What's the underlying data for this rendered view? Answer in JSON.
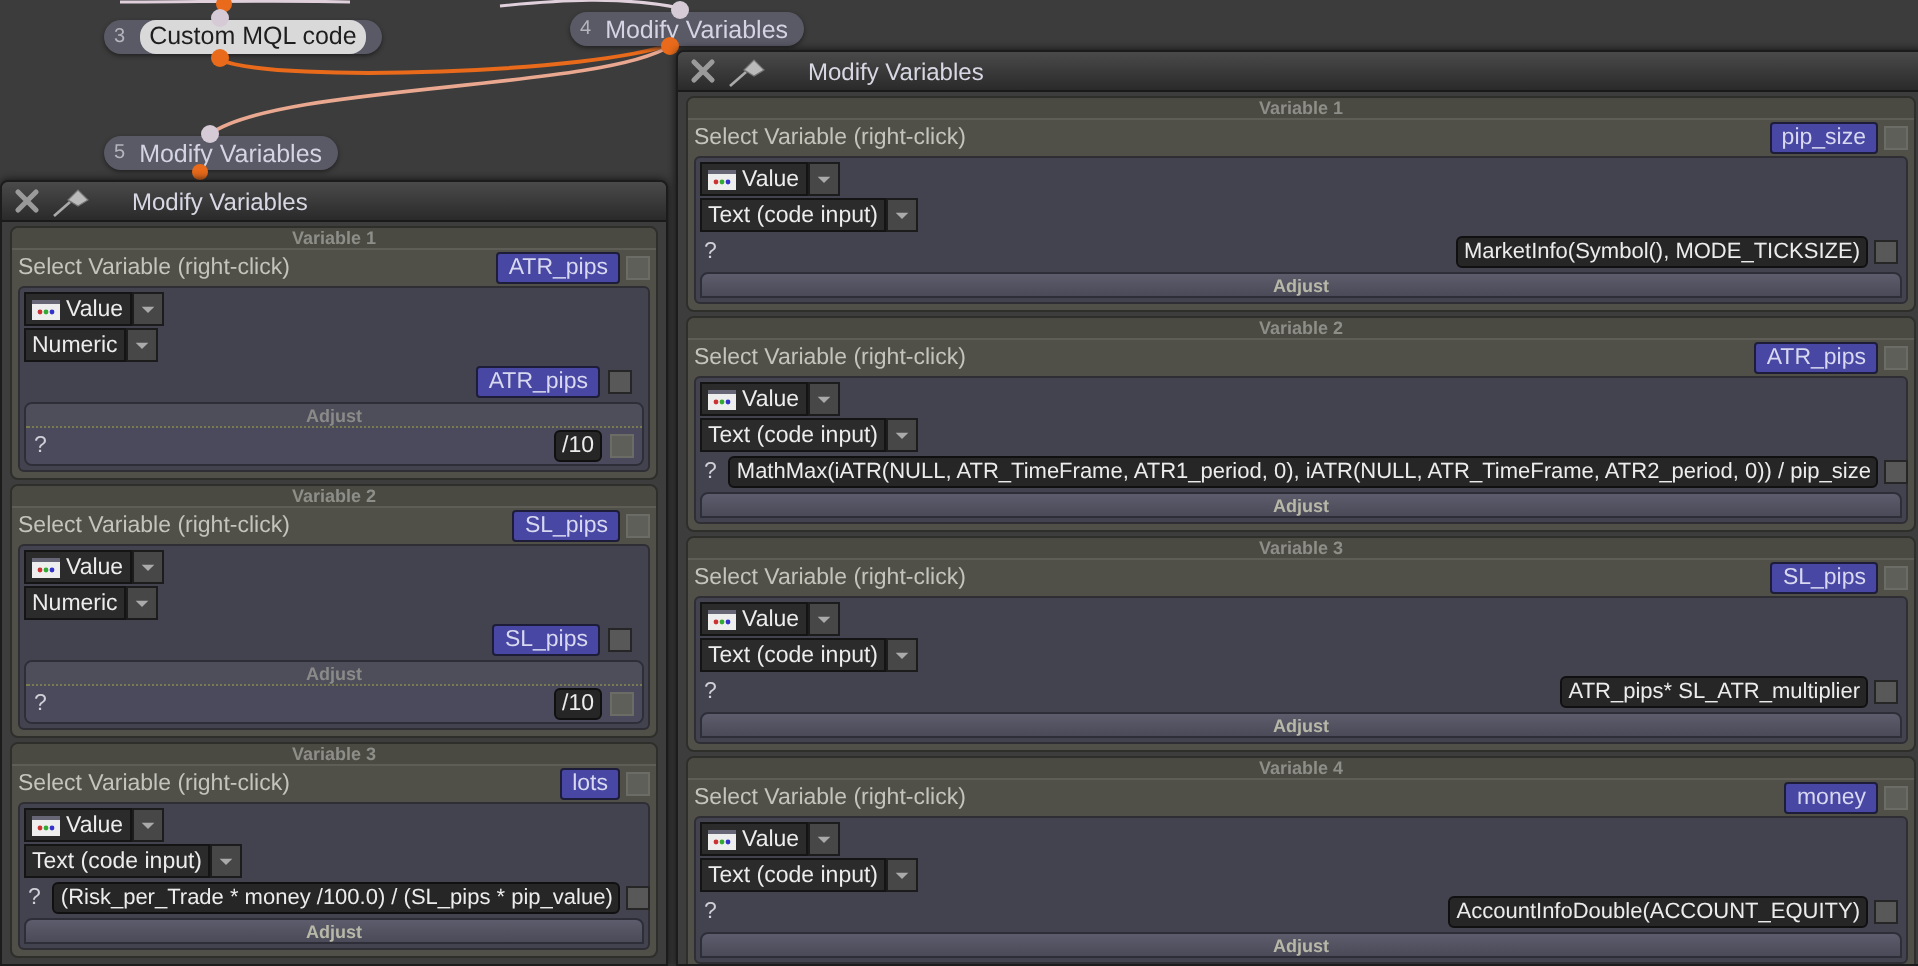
{
  "nodes": [
    {
      "number": "3",
      "label": "Custom MQL code",
      "selected": true
    },
    {
      "number": "4",
      "label": "Modify Variables",
      "selected": false
    },
    {
      "number": "5",
      "label": "Modify Variables",
      "selected": false
    }
  ],
  "windows": [
    {
      "title": "Modify Variables",
      "variables": [
        {
          "kind": "numeric",
          "header": "Variable 1",
          "select_label": "Select Variable (right-click)",
          "name": "ATR_pips",
          "name_checked": false,
          "source": "Value",
          "type": "Numeric",
          "target": "ATR_pips",
          "checked": false,
          "adjust_label": "Adjust",
          "question": "?",
          "adjust_value": "/10",
          "adjust_checked": false
        },
        {
          "kind": "numeric",
          "header": "Variable 2",
          "select_label": "Select Variable (right-click)",
          "name": "SL_pips",
          "name_checked": false,
          "source": "Value",
          "type": "Numeric",
          "target": "SL_pips",
          "checked": false,
          "adjust_label": "Adjust",
          "question": "?",
          "adjust_value": "/10",
          "adjust_checked": false
        },
        {
          "kind": "code",
          "header": "Variable 3",
          "select_label": "Select Variable (right-click)",
          "name": "lots",
          "name_checked": false,
          "source": "Value",
          "type": "Text (code input)",
          "question": "?",
          "expression": "(Risk_per_Trade * money /100.0) / (SL_pips * pip_value)",
          "checked": false,
          "adjust_label": "Adjust"
        }
      ]
    },
    {
      "title": "Modify Variables",
      "variables": [
        {
          "kind": "code",
          "header": "Variable 1",
          "select_label": "Select Variable (right-click)",
          "name": "pip_size",
          "name_checked": false,
          "source": "Value",
          "type": "Text (code input)",
          "question": "?",
          "expression": "MarketInfo(Symbol(), MODE_TICKSIZE)",
          "checked": false,
          "adjust_label": "Adjust"
        },
        {
          "kind": "code",
          "header": "Variable 2",
          "select_label": "Select Variable (right-click)",
          "name": "ATR_pips",
          "name_checked": false,
          "source": "Value",
          "type": "Text (code input)",
          "question": "?",
          "expression": "MathMax(iATR(NULL, ATR_TimeFrame, ATR1_period, 0), iATR(NULL, ATR_TimeFrame, ATR2_period, 0)) / pip_size",
          "checked": false,
          "adjust_label": "Adjust"
        },
        {
          "kind": "code",
          "header": "Variable 3",
          "select_label": "Select Variable (right-click)",
          "name": "SL_pips",
          "name_checked": false,
          "source": "Value",
          "type": "Text (code input)",
          "question": "?",
          "expression": "ATR_pips* SL_ATR_multiplier",
          "checked": false,
          "adjust_label": "Adjust"
        },
        {
          "kind": "code",
          "header": "Variable 4",
          "select_label": "Select Variable (right-click)",
          "name": "money",
          "name_checked": false,
          "source": "Value",
          "type": "Text (code input)",
          "question": "?",
          "expression": "AccountInfoDouble(ACCOUNT_EQUITY)",
          "checked": false,
          "adjust_label": "Adjust"
        }
      ]
    }
  ]
}
